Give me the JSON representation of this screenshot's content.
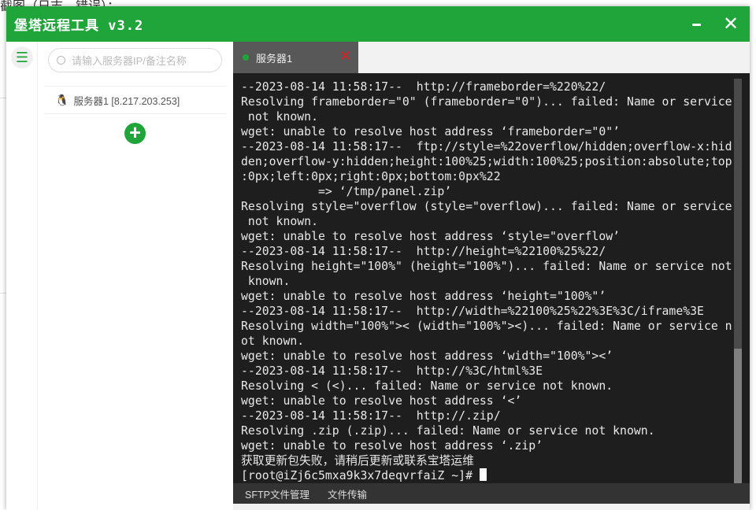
{
  "background": {
    "top_text": "截图（日志、错误）："
  },
  "window": {
    "title": "堡塔远程工具 v3.2",
    "minimize": "–",
    "close": "✕"
  },
  "sidebar": {
    "search_placeholder": "请输入服务器IP/备注名称",
    "servers": [
      {
        "label": "服务器1 [8.217.203.253]",
        "os_icon": "linux-penguin-icon"
      }
    ],
    "add_label": "+"
  },
  "tabs": [
    {
      "label": "服务器1",
      "status": "connected",
      "close": "✕"
    }
  ],
  "terminal": {
    "lines": [
      "--2023-08-14 11:58:17--  http://frameborder=%220%22/",
      "Resolving frameborder=\"0\" (frameborder=\"0\")... failed: Name or service",
      " not known.",
      "wget: unable to resolve host address ‘frameborder=\"0\"’",
      "--2023-08-14 11:58:17--  ftp://style=%22overflow/hidden;overflow-x:hid",
      "den;overflow-y:hidden;height:100%25;width:100%25;position:absolute;top",
      ":0px;left:0px;right:0px;bottom:0px%22",
      "           => ‘/tmp/panel.zip’",
      "Resolving style=\"overflow (style=\"overflow)... failed: Name or service",
      " not known.",
      "wget: unable to resolve host address ‘style=\"overflow’",
      "--2023-08-14 11:58:17--  http://height=%22100%25%22/",
      "Resolving height=\"100%\" (height=\"100%\")... failed: Name or service not",
      " known.",
      "wget: unable to resolve host address ‘height=\"100%\"’",
      "--2023-08-14 11:58:17--  http://width=%22100%25%22%3E%3C/iframe%3E",
      "Resolving width=\"100%\">< (width=\"100%\"><)... failed: Name or service n",
      "ot known.",
      "wget: unable to resolve host address ‘width=\"100%\"><’",
      "--2023-08-14 11:58:17--  http://%3C/html%3E",
      "Resolving < (<)... failed: Name or service not known.",
      "wget: unable to resolve host address ‘<’",
      "--2023-08-14 11:58:17--  http://.zip/",
      "Resolving .zip (.zip)... failed: Name or service not known.",
      "wget: unable to resolve host address ‘.zip’",
      "获取更新包失败，请稍后更新或联系宝塔运维"
    ],
    "prompt": "[root@iZj6c5mxa9k3x7deqvrfaiZ ~]# ",
    "scroll_position": 1.0
  },
  "footer": {
    "sftp": "SFTP文件管理",
    "transfer": "文件传输"
  },
  "colors": {
    "brand": "#20a53a",
    "terminal_bg": "#1e1e1e",
    "close_tab": "#e02020"
  }
}
